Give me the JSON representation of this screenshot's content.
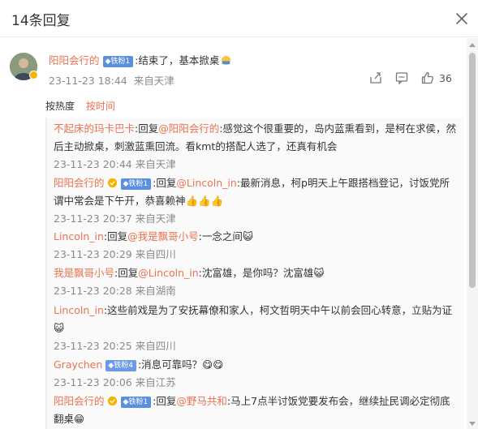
{
  "header": {
    "title": "14条回复"
  },
  "main_comment": {
    "username": "阳阳会行的",
    "fan_badge": "铁粉1",
    "text": ":结束了，基本掀桌",
    "time": "23-11-23 18:44",
    "location": "来自天津",
    "like_count": "36"
  },
  "sort": {
    "hot_label": "按热度",
    "time_label": "按时间"
  },
  "replies": [
    {
      "username": "不起床的玛卡巴卡",
      "prefix": ":回复",
      "mention": "@阳阳会行的",
      "text": ":感觉这个很重要的，岛内蓝熏看到，是柯在求侯，然后主动掀桌，刺激蓝熏回流。看kmt的搭配人选了，还真有机会",
      "time": "23-11-23 20:44 来自天津"
    },
    {
      "username": "阳阳会行的",
      "fan_badge": "铁粉1",
      "prefix": ":回复",
      "mention": "@Lincoln_in",
      "text": ":最新消息，柯p明天上午跟搭档登记，讨饭党所谓中常会是下午开，恭喜赖神👍👍👍",
      "time": "23-11-23 20:37 来自天津"
    },
    {
      "username": "Lincoln_in",
      "prefix": ":回复",
      "mention": "@我是飘哥小号",
      "text": ":一念之间😺",
      "time": "23-11-23 20:29 来自四川"
    },
    {
      "username": "我是飘哥小号",
      "prefix": ":回复",
      "mention": "@Lincoln_in",
      "text": ":沈富雄，是你吗？沈富雄😺",
      "time": "23-11-23 20:28 来自湖南"
    },
    {
      "username": "Lincoln_in",
      "prefix": "",
      "mention": "",
      "text": ":这些前戏是为了安抚幕僚和家人，柯文哲明天中午以前会回心转意，立贴为证😺",
      "time": "23-11-23 20:25 来自四川"
    },
    {
      "username": "Graychen",
      "fan_badge": "铁粉4",
      "prefix": "",
      "mention": "",
      "text": ":消息可靠吗？😋😋",
      "time": "23-11-23 20:06 来自江苏"
    },
    {
      "username": "阳阳会行的",
      "fan_badge": "铁粉1",
      "prefix": ":回复",
      "mention": "@野马共和",
      "text": ":马上7点半讨饭党要发布会，继续扯民调必定彻底翻桌😁",
      "time": ""
    }
  ]
}
